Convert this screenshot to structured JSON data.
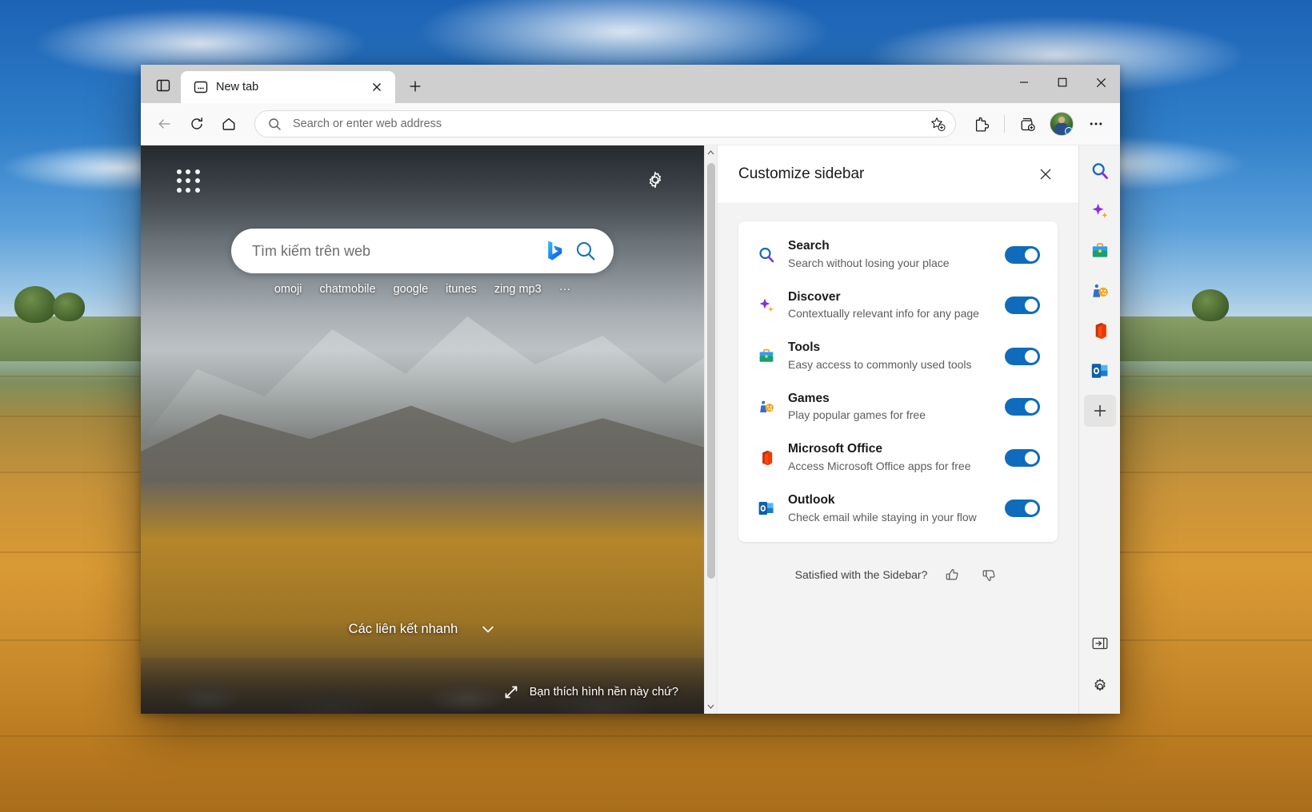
{
  "window": {
    "tab": {
      "title": "New tab",
      "icon": "new-tab-page-icon",
      "close_label": "×"
    },
    "tab_search_label": "Tab actions",
    "new_tab_label": "+",
    "controls": {
      "minimize": "—",
      "maximize": "☐",
      "close": "✕"
    }
  },
  "toolbar": {
    "back_label": "Back",
    "refresh_label": "Refresh",
    "home_label": "Home",
    "address_placeholder": "Search or enter web address",
    "favorite_label": "Add this page to favorites",
    "extensions_label": "Extensions",
    "collections_label": "Collections",
    "profile_label": "Profile",
    "settings_label": "Settings and more"
  },
  "newtab": {
    "app_launcher_label": "App launcher",
    "page_settings_label": "Page settings",
    "search_placeholder": "Tìm kiếm trên web",
    "bing_label": "Bing Chat",
    "search_button_label": "Search",
    "suggestions": [
      "omoji",
      "chatmobile",
      "google",
      "itunes",
      "zing mp3",
      "···"
    ],
    "quick_links_label": "Các liên kết nhanh",
    "quick_links_chevron": "chevron-down-icon",
    "wallpaper_prompt": "Bạn thích hình nền này chứ?",
    "wallpaper_icon": "expand-arrow-icon"
  },
  "panel": {
    "title": "Customize sidebar",
    "close_label": "✕",
    "items": [
      {
        "title": "Search",
        "desc": "Search without losing your place",
        "icon": "search-icon",
        "enabled": true
      },
      {
        "title": "Discover",
        "desc": "Contextually relevant info for any page",
        "icon": "discover-sparkle-icon",
        "enabled": true
      },
      {
        "title": "Tools",
        "desc": "Easy access to commonly used tools",
        "icon": "tools-briefcase-icon",
        "enabled": true
      },
      {
        "title": "Games",
        "desc": "Play popular games for free",
        "icon": "games-icon",
        "enabled": true
      },
      {
        "title": "Microsoft Office",
        "desc": "Access Microsoft Office apps for free",
        "icon": "microsoft-office-icon",
        "enabled": true
      },
      {
        "title": "Outlook",
        "desc": "Check email while staying in your flow",
        "icon": "outlook-icon",
        "enabled": true
      }
    ],
    "feedback": {
      "question": "Satisfied with the Sidebar?",
      "thumbs_up_label": "Thumbs up",
      "thumbs_down_label": "Thumbs down"
    }
  },
  "rail": {
    "items": [
      {
        "label": "Search",
        "icon": "search-icon"
      },
      {
        "label": "Discover",
        "icon": "discover-sparkle-icon"
      },
      {
        "label": "Tools",
        "icon": "tools-briefcase-icon"
      },
      {
        "label": "Games",
        "icon": "games-icon"
      },
      {
        "label": "Microsoft Office",
        "icon": "microsoft-office-icon"
      },
      {
        "label": "Outlook",
        "icon": "outlook-icon"
      }
    ],
    "add_label": "+",
    "collapse_label": "Collapse sidebar",
    "settings_label": "Sidebar settings"
  },
  "colors": {
    "accent": "#0f6cbd",
    "toggle_on": "#0f6cbd",
    "panel_bg": "#f3f3f3",
    "toolbar_bg": "#f9f9f9",
    "tabstrip_bg": "#cfcfcf"
  }
}
